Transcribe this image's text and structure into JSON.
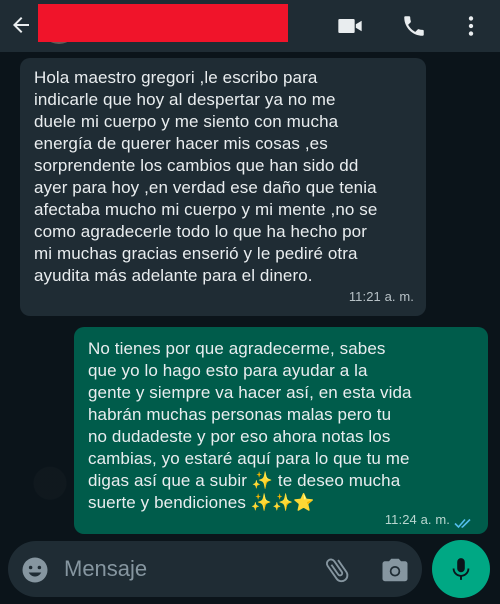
{
  "header": {
    "back_icon": "arrow-left-icon",
    "video_icon": "video-call-icon",
    "call_icon": "phone-icon",
    "menu_icon": "more-vertical-icon"
  },
  "messages": [
    {
      "direction": "incoming",
      "text": "Hola maestro gregori ,le escribo para\nindicarle que hoy al despertar ya no me\nduele mi cuerpo y me siento con mucha\nenergía de querer hacer mis cosas ,es\nsorprendente los cambios que han sido dd\nayer para hoy ,en verdad ese daño que tenia\nafectaba mucho mi cuerpo y mi mente ,no se\ncomo agradecerle todo lo que ha hecho por\nmi muchas gracias enserió y le pediré otra\nayudita más adelante para el dinero.",
      "time": "11:21 a. m."
    },
    {
      "direction": "outgoing",
      "text": "No tienes por que agradecerme, sabes\nque yo lo hago esto para ayudar a la\ngente y siempre va hacer así, en esta vida\nhabrán muchas personas malas pero tu\nno dudadeste y por eso ahora notas los\ncambias, yo estaré aquí para lo que tu me\ndigas así que a subir ✨ te deseo mucha\nsuerte y bendiciones ✨✨⭐",
      "time": "11:24 a. m.",
      "status": "read"
    }
  ],
  "input": {
    "placeholder": "Mensaje"
  },
  "colors": {
    "background": "#0b141a",
    "header": "#1f2c34",
    "incoming_bubble": "#1f2c34",
    "outgoing_bubble": "#005c4b",
    "accent": "#00a884",
    "read_ticks": "#53bdeb"
  }
}
